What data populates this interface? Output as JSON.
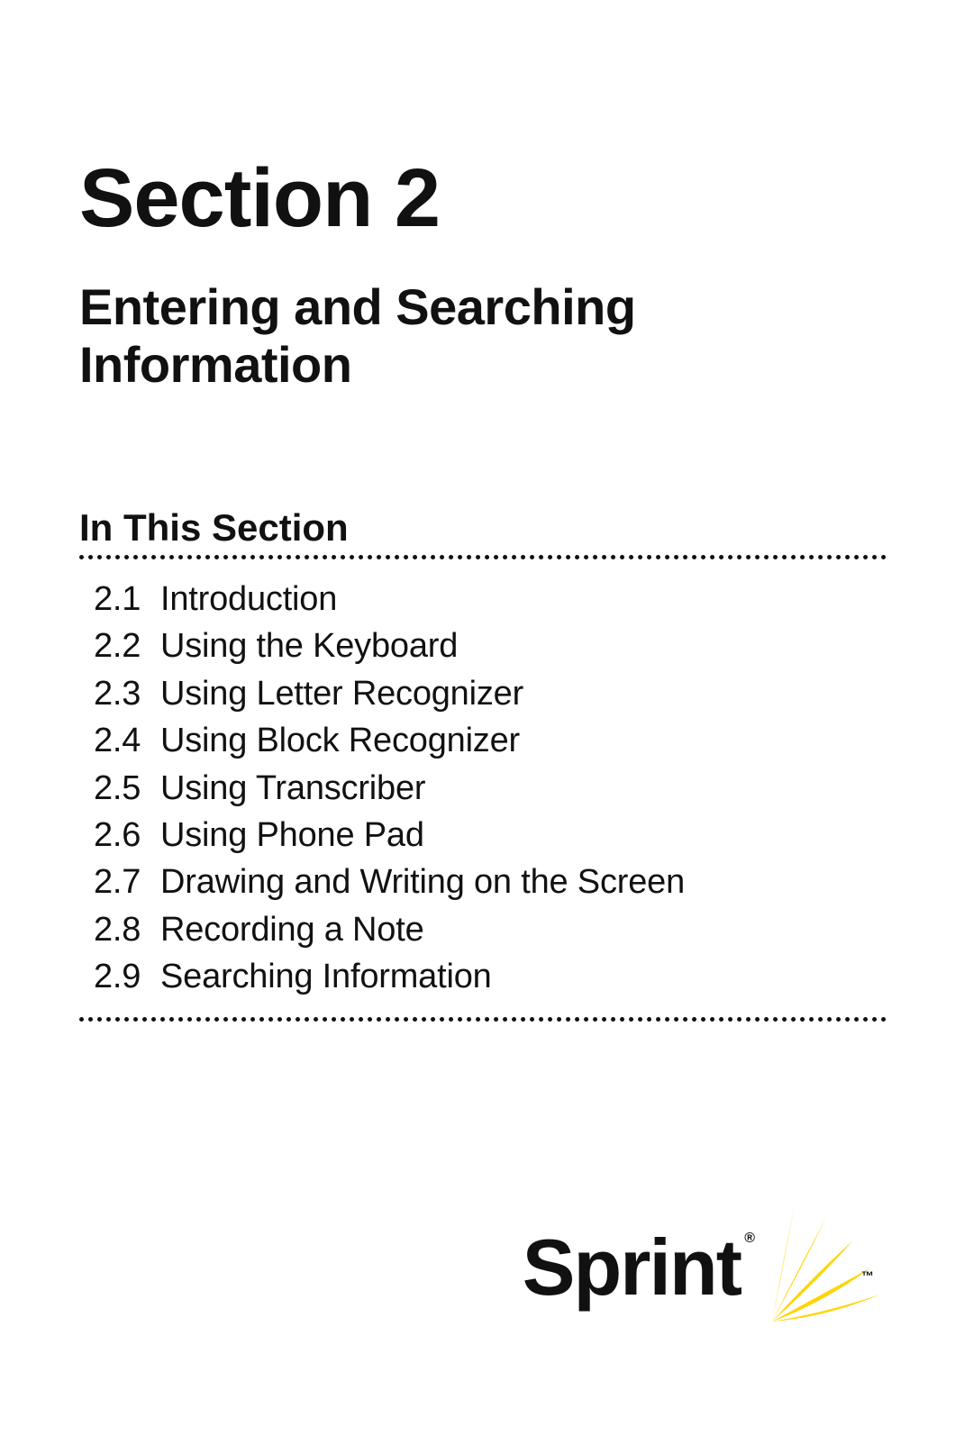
{
  "section": {
    "number": "Section 2",
    "title": "Entering and Searching Information"
  },
  "toc": {
    "heading": "In This Section",
    "items": [
      {
        "num": "2.1",
        "title": "Introduction"
      },
      {
        "num": "2.2",
        "title": "Using the Keyboard"
      },
      {
        "num": "2.3",
        "title": "Using Letter Recognizer"
      },
      {
        "num": "2.4",
        "title": "Using Block Recognizer"
      },
      {
        "num": "2.5",
        "title": "Using Transcriber"
      },
      {
        "num": "2.6",
        "title": "Using Phone Pad"
      },
      {
        "num": "2.7",
        "title": "Drawing and Writing on the Screen"
      },
      {
        "num": "2.8",
        "title": "Recording a Note"
      },
      {
        "num": "2.9",
        "title": "Searching Information"
      }
    ]
  },
  "brand": {
    "name": "Sprint",
    "registered": "®",
    "tm": "™"
  }
}
